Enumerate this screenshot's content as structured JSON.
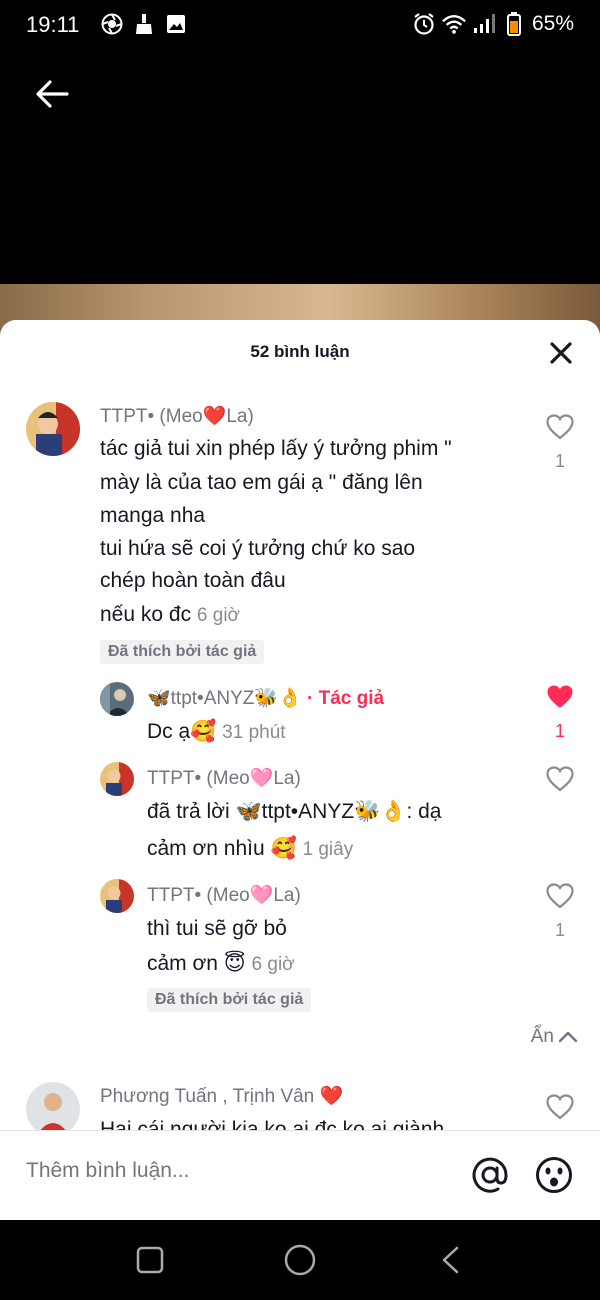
{
  "status_bar": {
    "time": "19:11",
    "battery": "65%"
  },
  "sheet": {
    "title": "52 bình luận"
  },
  "comments": [
    {
      "username": "TTPT• (Meo❤️La)",
      "lines": [
        "tác giả tui xin phép lấy ý tưởng phim \"",
        "mày là của tao em gái ạ \" đăng lên",
        "manga nha",
        "tui hứa sẽ coi ý tưởng chứ ko sao",
        "chép hoàn toàn đâu",
        "nếu ko đc"
      ],
      "time": "6 giờ",
      "badge": "Đã thích bởi tác giả",
      "likes": "1"
    },
    {
      "username": "🦋ttpt•ANYZ🐝👌",
      "author_tag": "· Tác giả",
      "text": "Dc ạ🥰",
      "time": "31 phút",
      "likes": "1"
    },
    {
      "username": "TTPT• (Meo🩷La)",
      "lines": [
        "đã trả lời 🦋ttpt•ANYZ🐝👌: dạ",
        "cảm ơn nhìu 🥰"
      ],
      "time": "1 giây"
    },
    {
      "username": "TTPT• (Meo🩷La)",
      "lines": [
        "thì tui sẽ gỡ bỏ",
        "cảm ơn 😇"
      ],
      "time": "6 giờ",
      "badge": "Đã thích bởi tác giả",
      "likes": "1"
    },
    {
      "username": "Phương Tuấn , Trịnh Vân ❤️",
      "text": "Hai cái người kia ko ai đc ko ai giành"
    }
  ],
  "hide_label": "Ẩn",
  "input": {
    "placeholder": "Thêm bình luận..."
  },
  "colors": {
    "accent": "#fe2c55",
    "text": "#161823",
    "muted": "#737480"
  }
}
